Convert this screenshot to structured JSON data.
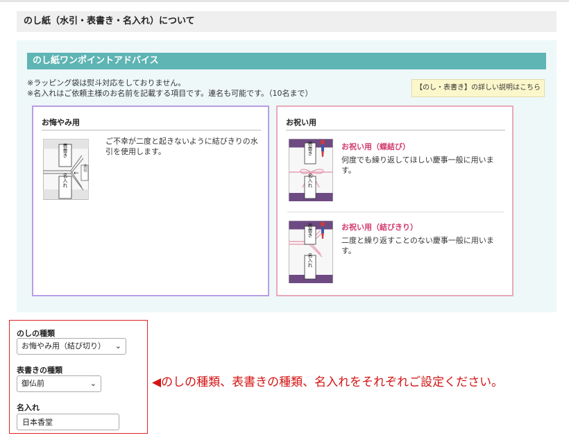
{
  "section": {
    "title": "のし紙（水引・表書き・名入れ）について"
  },
  "advice": {
    "title": "のし紙ワンポイントアドバイス",
    "notes": [
      "※ラッピング袋は熨斗対応をしておりません。",
      "※名入れはご依頼主様のお名前を記載する項目です。連名も可能です。（10名まで）"
    ],
    "detail_link": "【のし・表書き】の詳しい説明はこちら"
  },
  "okuyami": {
    "title": "お悔やみ用",
    "text": "ご不幸が二度と起きないように結びきりの水引を使用します。",
    "image": {
      "omotegaki": "表書き",
      "mizuhiki": "水引",
      "naire": "名入れ",
      "arrow": "←"
    }
  },
  "oiwai": {
    "title": "お祝い用",
    "items": [
      {
        "heading": "お祝い用（蝶結び）",
        "text": "何度でも繰り返してほしい慶事一般に用います。",
        "image": {
          "omotegaki": "表書き",
          "naire": "名入れ"
        }
      },
      {
        "heading": "お祝い用（結びきり）",
        "text": "二度と繰り返すことのない慶事一般に用います。",
        "image": {
          "omotegaki": "表書き",
          "naire": "名入れ"
        }
      }
    ]
  },
  "form": {
    "noshi_type": {
      "label": "のしの種類",
      "value": "お悔やみ用（結び切り）"
    },
    "omotegaki_type": {
      "label": "表書きの種類",
      "value": "御仏前"
    },
    "naire": {
      "label": "名入れ",
      "value": "日本香堂"
    }
  },
  "instruction": "◀のしの種類、表書きの種類、名入れをそれぞれご設定ください。",
  "colors": {
    "advice_title_bg": "#5fb4b4",
    "okuyami_border": "#b79ee6",
    "oiwai_border": "#e8a9b8",
    "accent_red": "#d41414",
    "item_heading": "#d23c6e"
  }
}
